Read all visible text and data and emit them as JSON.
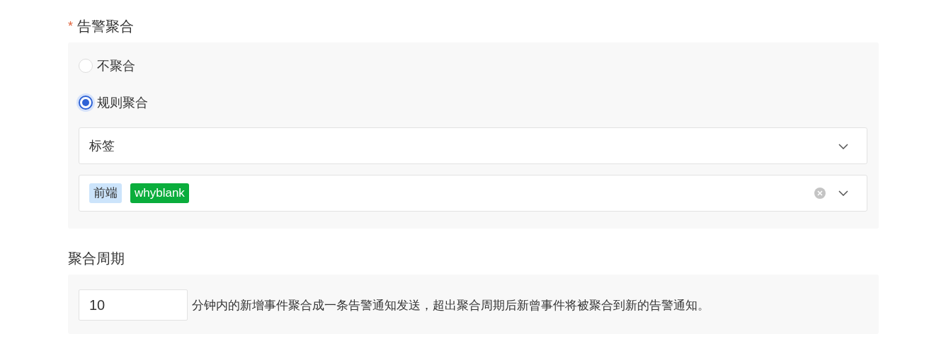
{
  "aggregation": {
    "label": "告警聚合",
    "required_mark": "*",
    "options": [
      {
        "label": "不聚合",
        "selected": false
      },
      {
        "label": "规则聚合",
        "selected": true
      }
    ],
    "dimension_select": {
      "value": "标签"
    },
    "tag_select": {
      "tags": [
        {
          "label": "前端",
          "color": "#cce4fb"
        },
        {
          "label": "whyblank",
          "color": "#0aad3c"
        }
      ],
      "clearable": true
    }
  },
  "period": {
    "label": "聚合周期",
    "value": "10",
    "description": "分钟内的新增事件聚合成一条告警通知发送，超出聚合周期后新曾事件将被聚合到新的告警通知。"
  }
}
